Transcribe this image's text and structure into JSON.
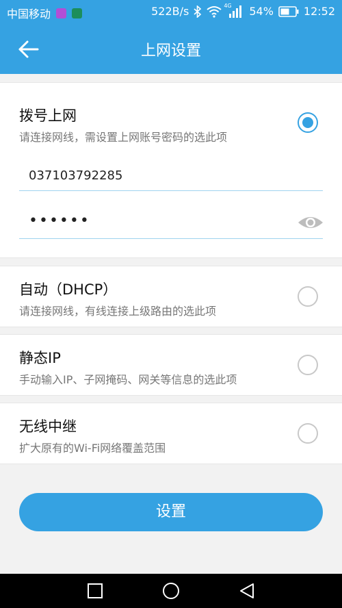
{
  "status_bar": {
    "carrier": "中国移动",
    "speed": "522B/s",
    "network_type": "4G",
    "battery": "54%",
    "time": "12:52",
    "icons": [
      "bluetooth-icon",
      "wifi-icon",
      "signal-icon",
      "battery-icon"
    ]
  },
  "header": {
    "title": "上网设置",
    "back_icon": "arrow-left-icon"
  },
  "options": [
    {
      "title": "拨号上网",
      "desc": "请连接网线，需设置上网账号密码的选此项",
      "selected": true
    },
    {
      "title": "自动（DHCP）",
      "desc": "请连接网线，有线连接上级路由的选此项",
      "selected": false
    },
    {
      "title": "静态IP",
      "desc": "手动输入IP、子网掩码、网关等信息的选此项",
      "selected": false
    },
    {
      "title": "无线中继",
      "desc": "扩大原有的Wi-Fi网络覆盖范围",
      "selected": false
    }
  ],
  "account_field": {
    "value": "037103792285"
  },
  "password_field": {
    "value": "••••••",
    "eye_icon": "eye-icon"
  },
  "submit_label": "设置",
  "colors": {
    "accent": "#35a2e2"
  },
  "nav_icons": [
    "square-icon",
    "circle-icon",
    "triangle-back-icon"
  ]
}
